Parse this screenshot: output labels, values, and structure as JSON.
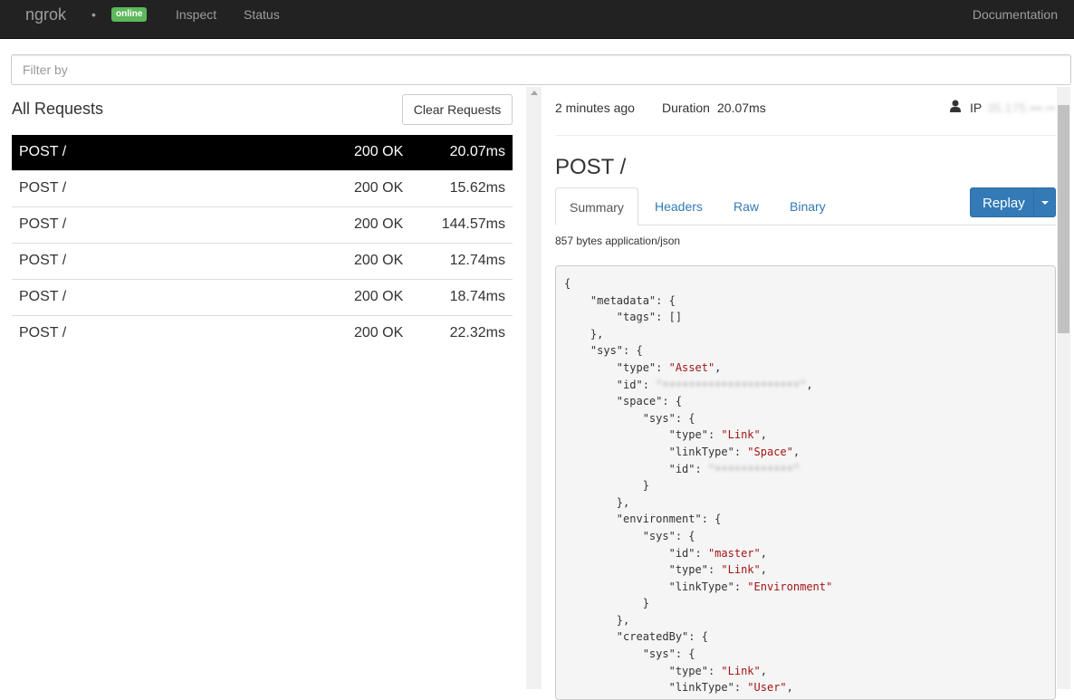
{
  "nav": {
    "brand": "ngrok",
    "dot": "•",
    "status_badge": "online",
    "links": [
      "Inspect",
      "Status"
    ],
    "docs": "Documentation"
  },
  "filter": {
    "placeholder": "Filter by"
  },
  "requests": {
    "title": "All Requests",
    "clear_label": "Clear Requests",
    "rows": [
      {
        "method": "POST /",
        "status": "200 OK",
        "duration": "20.07ms",
        "selected": true
      },
      {
        "method": "POST /",
        "status": "200 OK",
        "duration": "15.62ms"
      },
      {
        "method": "POST /",
        "status": "200 OK",
        "duration": "144.57ms"
      },
      {
        "method": "POST /",
        "status": "200 OK",
        "duration": "12.74ms"
      },
      {
        "method": "POST /",
        "status": "200 OK",
        "duration": "18.74ms"
      },
      {
        "method": "POST /",
        "status": "200 OK",
        "duration": "22.32ms"
      }
    ]
  },
  "detail": {
    "time_ago": "2 minutes ago",
    "duration_label": "Duration",
    "duration": "20.07ms",
    "ip_label": "IP",
    "ip_value": "35.175.•••.•••",
    "title": "POST /",
    "tabs": [
      "Summary",
      "Headers",
      "Raw",
      "Binary"
    ],
    "active_tab": "Summary",
    "replay_label": "Replay",
    "summary": "857 bytes application/json"
  },
  "json_body": [
    "{",
    "    \"metadata\": {",
    "        \"tags\": []",
    "    },",
    "    \"sys\": {",
    "        \"type\": \"Asset\",",
    "        \"id\": \"•••••••••••••••••••••\",",
    "        \"space\": {",
    "            \"sys\": {",
    "                \"type\": \"Link\",",
    "                \"linkType\": \"Space\",",
    "                \"id\": \"••••••••••••\"",
    "            }",
    "        },",
    "        \"environment\": {",
    "            \"sys\": {",
    "                \"id\": \"master\",",
    "                \"type\": \"Link\",",
    "                \"linkType\": \"Environment\"",
    "            }",
    "        },",
    "        \"createdBy\": {",
    "            \"sys\": {",
    "                \"type\": \"Link\",",
    "                \"linkType\": \"User\","
  ],
  "colors": {
    "navbar": "#222222",
    "online": "#5cb85c",
    "primary": "#337ab7",
    "selected_row": "#000000",
    "json_string": "#a31515"
  }
}
